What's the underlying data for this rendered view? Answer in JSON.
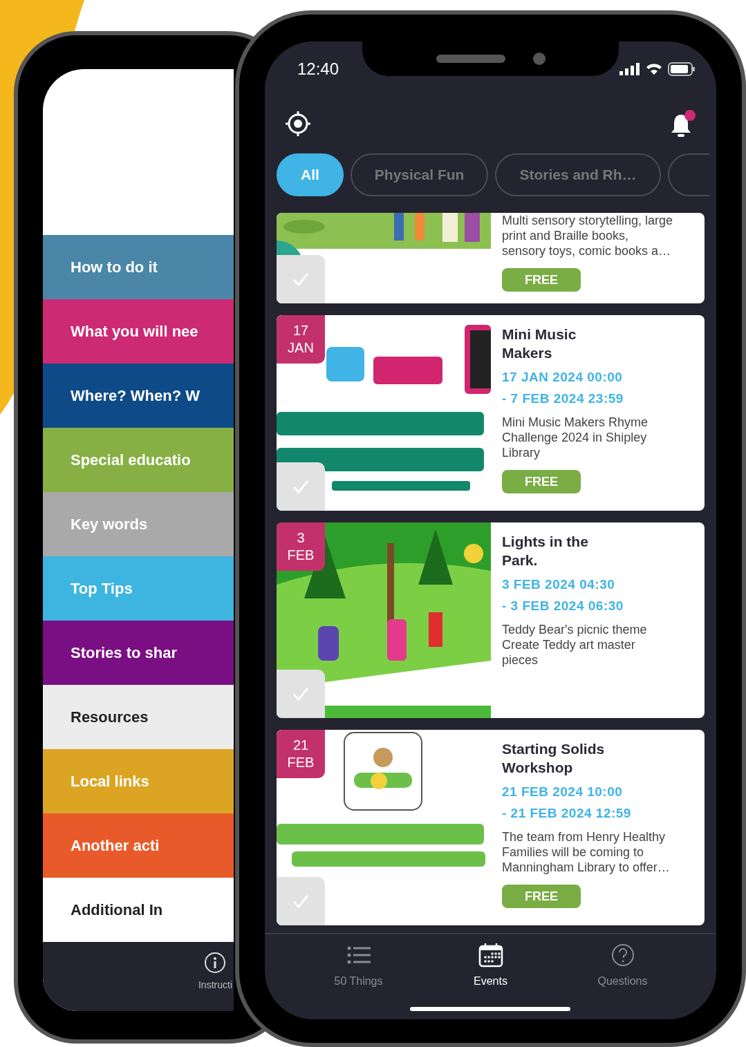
{
  "back_phone": {
    "sections": [
      {
        "label": "How to do it",
        "color": "#4a86a8"
      },
      {
        "label": "What you will nee",
        "color": "#cc2a72"
      },
      {
        "label": "Where? When? W",
        "color": "#0f4a88"
      },
      {
        "label": "Special educatio",
        "color": "#86b043"
      },
      {
        "label": "Key words",
        "color": "#a9a9a9"
      },
      {
        "label": "Top Tips",
        "color": "#3db5e0"
      },
      {
        "label": "Stories to shar",
        "color": "#7a0f83"
      },
      {
        "label": "Resources",
        "color": "#ececec"
      },
      {
        "label": "Local links",
        "color": "#dba523"
      },
      {
        "label": "Another acti",
        "color": "#e85a2a"
      },
      {
        "label": "Additional In",
        "color": "#ffffff"
      }
    ],
    "tab": {
      "label": "Instructi"
    }
  },
  "status_bar": {
    "time": "12:40"
  },
  "header": {
    "notification_unread": true
  },
  "filters": [
    {
      "label": "All",
      "selected": true
    },
    {
      "label": "Physical Fun",
      "selected": false
    },
    {
      "label": "Stories and Rh…",
      "selected": false
    }
  ],
  "events": [
    {
      "description": "Multi sensory storytelling, large print and Braille books, sensory toys, comic books a…",
      "price": "FREE",
      "checked": false
    },
    {
      "day": "17",
      "month": "JAN",
      "title": "Mini Music Makers",
      "start": "17 JAN 2024 00:00",
      "end": "- 7 FEB 2024 23:59",
      "description": "Mini Music Makers Rhyme Challenge 2024 in Shipley Library",
      "price": "FREE",
      "checked": false
    },
    {
      "day": "3",
      "month": "FEB",
      "title": "Lights in the Park.",
      "start": "3 FEB 2024 04:30",
      "end": "- 3 FEB 2024 06:30",
      "description": "Teddy Bear's picnic theme Create Teddy art master pieces",
      "checked": false
    },
    {
      "day": "21",
      "month": "FEB",
      "title": "Starting Solids Workshop",
      "start": "21 FEB 2024 10:00",
      "end": "- 21 FEB 2024 12:59",
      "description": "The team from Henry Healthy Families will be coming to Manningham Library to offer…",
      "price": "FREE",
      "checked": false
    }
  ],
  "nav": [
    {
      "label": "50 Things",
      "kind": "list",
      "selected": false
    },
    {
      "label": "Events",
      "kind": "calendar",
      "selected": true
    },
    {
      "label": "Questions",
      "kind": "help",
      "selected": false
    }
  ]
}
